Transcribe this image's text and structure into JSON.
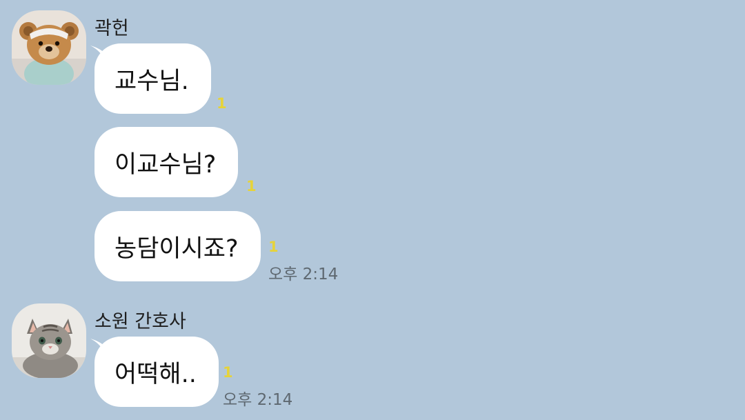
{
  "groups": [
    {
      "sender": "곽헌",
      "avatar_icon": "teddy-bear-avatar",
      "messages": [
        {
          "text": "교수님.",
          "unread": "1"
        },
        {
          "text": "이교수님?",
          "unread": "1"
        },
        {
          "text": "농담이시죠?",
          "unread": "1",
          "time": "오후 2:14"
        }
      ]
    },
    {
      "sender": "소원 간호사",
      "avatar_icon": "kitten-avatar",
      "messages": [
        {
          "text": "어떡해..",
          "unread": "1",
          "time": "오후 2:14"
        }
      ]
    }
  ],
  "colors": {
    "background": "#b2c7da",
    "bubble": "#ffffff",
    "unread": "#e6d33a",
    "time": "#5e6870"
  }
}
